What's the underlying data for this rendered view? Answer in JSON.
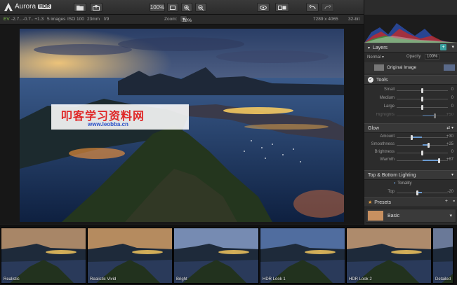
{
  "app": {
    "name": "Aurora",
    "badge": "HDR"
  },
  "toolbar": {
    "zoom_label": "100%"
  },
  "status": {
    "ev": "EV",
    "ev_values": "-2.7...-0.7...+1.3",
    "images": "5 images",
    "iso": "ISO 100",
    "focal": "23mm",
    "aperture": "f/9",
    "zoom_label": "Zoom:",
    "zoom_value": "28%",
    "dimensions": "7289 x 4065",
    "bits": "32-bit"
  },
  "watermark": {
    "title": "叩客学习资料网",
    "url": "www.leobba.cn"
  },
  "layers": {
    "title": "Layers",
    "blend": "Normal",
    "opacity_label": "Opacity",
    "opacity_value": "100%",
    "layer_name": "Original Image"
  },
  "tools": {
    "title": "Tools",
    "rows": [
      {
        "label": "Small",
        "value": "0",
        "level": 0.5
      },
      {
        "label": "Medium",
        "value": "0",
        "level": 0.5
      },
      {
        "label": "Large",
        "value": "0",
        "level": 0.5
      },
      {
        "label": "Highlights",
        "value": "+50",
        "level": 0.75,
        "dim": true
      }
    ]
  },
  "glow": {
    "title": "Glow",
    "rows": [
      {
        "label": "Amount",
        "value": "+30",
        "level": 0.3
      },
      {
        "label": "Smoothness",
        "value": "+25",
        "level": 0.625
      },
      {
        "label": "Brightness",
        "value": "0",
        "level": 0.5
      },
      {
        "label": "Warmth",
        "value": "+67",
        "level": 0.83
      }
    ]
  },
  "lighting": {
    "title": "Top & Bottom Lighting",
    "tonality_label": "Tonality",
    "rows": [
      {
        "label": "Top",
        "value": "-20",
        "level": 0.4
      }
    ]
  },
  "presets": {
    "title": "Presets",
    "category": "Basic"
  },
  "filmstrip": [
    {
      "label": "Realistic"
    },
    {
      "label": "Realistic Vivid"
    },
    {
      "label": "Bright"
    },
    {
      "label": "HDR Look 1"
    },
    {
      "label": "HDR Look 2"
    },
    {
      "label": "Detailed"
    }
  ],
  "colors": {
    "accent": "#d0782a",
    "panel": "#2c2c2c",
    "slider": "#6a9ad0",
    "ev": "#7fc04a"
  }
}
